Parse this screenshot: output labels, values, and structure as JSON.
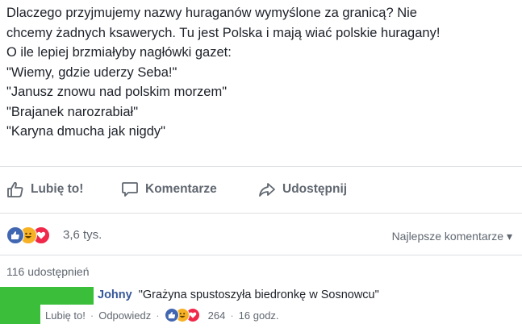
{
  "post": {
    "lines": [
      "Dlaczego przyjmujemy nazwy huraganów wymyślone za granicą? Nie",
      "chcemy żadnych ksawerych. Tu jest Polska i mają wiać polskie huragany!",
      "O ile lepiej brzmiałyby nagłówki gazet:",
      "\"Wiemy, gdzie uderzy Seba!\"",
      "\"Janusz znowu nad polskim morzem\"",
      "\"Brajanek narozrabiał\"",
      "\"Karyna dmucha jak nigdy\""
    ]
  },
  "actions": {
    "like": "Lubię to!",
    "comment": "Komentarze",
    "share": "Udostępnij"
  },
  "reactions": {
    "icons": [
      "like-icon",
      "haha-icon",
      "love-icon"
    ],
    "count": "3,6 tys.",
    "sort": "Najlepsze komentarze ▾"
  },
  "shares": {
    "text": "116 udostępnień"
  },
  "comment": {
    "author": "Johny",
    "text": "\"Grażyna spustoszyła biedronkę w Sosnowcu\"",
    "like_link": "Lubię to!",
    "reply_link": "Odpowiedz",
    "separator": "·",
    "reaction_count": "264",
    "time": "16 godz."
  },
  "colors": {
    "like_blue": "#4267b2",
    "love_red": "#f0284a",
    "haha_yellow": "#f7b125",
    "redaction_green": "#3bbf3b",
    "link_blue": "#365899"
  }
}
